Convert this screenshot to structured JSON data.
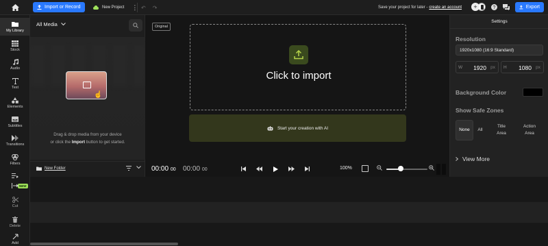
{
  "topbar": {
    "import_label": "Import or Record",
    "project_name": "New Project",
    "save_prompt": "Save your project for later -",
    "create_account": "create an account",
    "export_label": "Export"
  },
  "nav": {
    "items": [
      {
        "label": "My Library",
        "icon": "folder-icon"
      },
      {
        "label": "Stock",
        "icon": "stock-icon"
      },
      {
        "label": "Audio",
        "icon": "music-note-icon"
      },
      {
        "label": "Text",
        "icon": "text-icon"
      },
      {
        "label": "Elements",
        "icon": "shapes-icon"
      },
      {
        "label": "Subtitles",
        "icon": "subtitles-icon"
      },
      {
        "label": "Transitions",
        "icon": "transitions-icon"
      },
      {
        "label": "Filters",
        "icon": "filters-icon"
      },
      {
        "label": "",
        "icon": "auto-edit-icon"
      },
      {
        "label": "",
        "icon": "split-icon"
      },
      {
        "label": "Cut",
        "icon": "scissors-icon"
      },
      {
        "label": "Delete",
        "icon": "trash-icon"
      },
      {
        "label": "Add",
        "icon": "add-clip-icon"
      }
    ],
    "new_badge": "NEW"
  },
  "library": {
    "filter_label": "All Media",
    "drop_line1": "Drag & drop media from your device",
    "drop_line2_pre": "or click the ",
    "drop_line2_bold": "Import",
    "drop_line2_post": " button to get started.",
    "new_folder": "New Folder"
  },
  "preview": {
    "original_tag": "Original",
    "import_title": "Click to import",
    "ai_label": "Start your creation with AI"
  },
  "transport": {
    "current_main": "00:00",
    "current_frac": "00",
    "total_main": "00:00",
    "total_frac": "00",
    "zoom": "100%",
    "zoom_level": 0.35
  },
  "settings": {
    "header": "Settings",
    "resolution_label": "Resolution",
    "resolution_value": "1920x1080 (16:9 Standard)",
    "width_key": "W",
    "width_value": "1920",
    "height_key": "H",
    "height_value": "1080",
    "unit": "px",
    "bg_color_label": "Background Color",
    "bg_color": "#000000",
    "safe_zones_label": "Show Safe Zones",
    "zones": [
      "None",
      "All",
      "Title Area",
      "Action Area"
    ],
    "view_more": "View More"
  },
  "colors": {
    "accent": "#2979ff",
    "ai_bar": "#33371c",
    "badge": "#9ee05a"
  }
}
